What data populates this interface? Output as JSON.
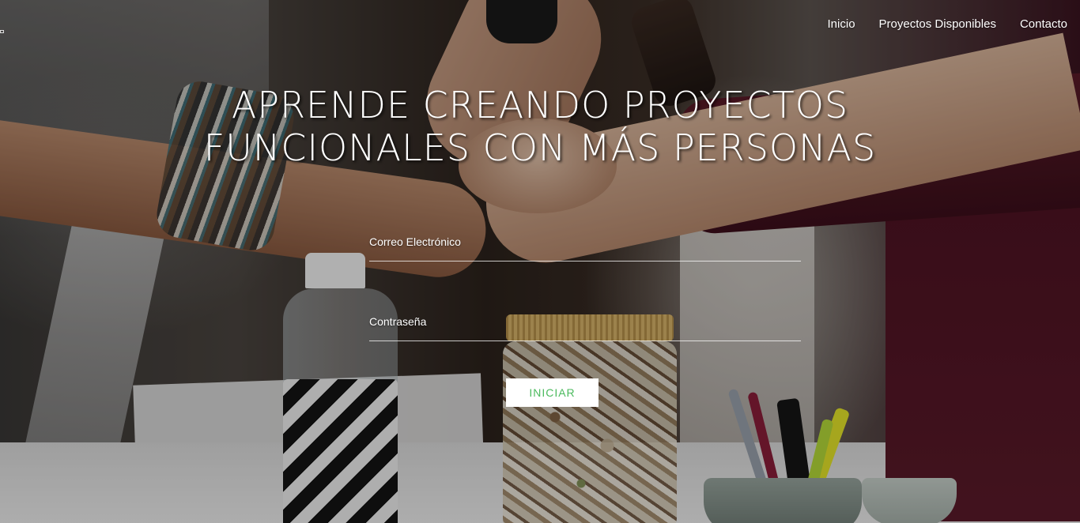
{
  "nav": {
    "items": [
      {
        "label": "Inicio"
      },
      {
        "label": "Proyectos Disponibles"
      },
      {
        "label": "Contacto"
      }
    ]
  },
  "hero": {
    "title_line1": "APRENDE CREANDO PROYECTOS",
    "title_line2": "FUNCIONALES CON MÁS PERSONAS"
  },
  "login_form": {
    "email_label": "Correo Electrónico",
    "email_value": "",
    "password_label": "Contraseña",
    "password_value": "",
    "submit_label": "INICIAR"
  },
  "colors": {
    "accent_green": "#4cba5e",
    "text_white": "#ffffff",
    "button_bg": "#ffffff"
  }
}
